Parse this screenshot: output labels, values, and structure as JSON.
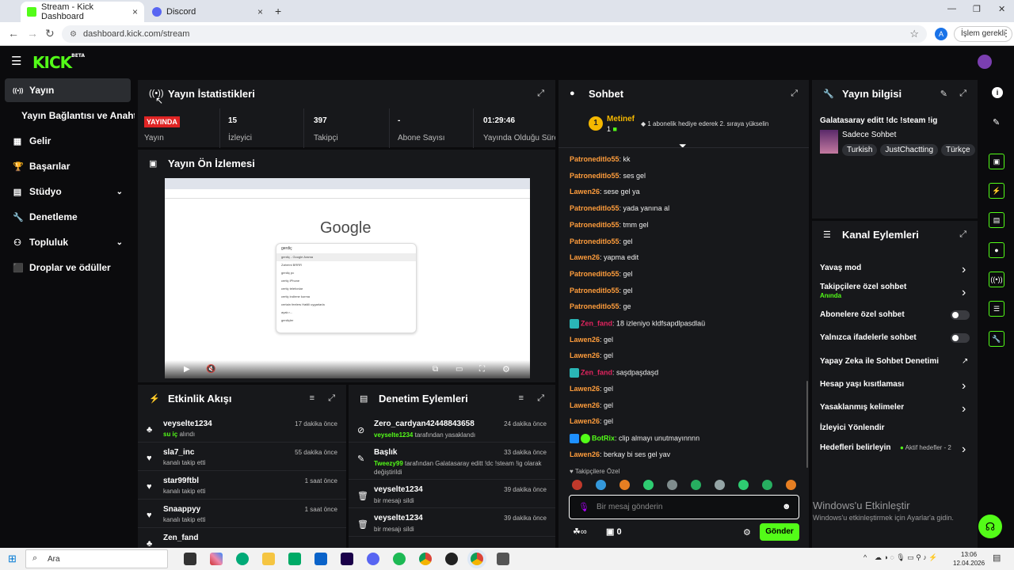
{
  "browser": {
    "tabs": [
      {
        "title": "Stream - Kick Dashboard",
        "close": "×"
      },
      {
        "title": "Discord",
        "close": "×"
      }
    ],
    "new_tab": "+",
    "url": "dashboard.kick.com/stream",
    "update_label": "İşlem gerekli",
    "profile_initial": "A",
    "window_controls": [
      "—",
      "❐",
      "✕"
    ]
  },
  "kick": {
    "logo": "KICK",
    "logo_sup": "BETA"
  },
  "sidebar": {
    "items": [
      {
        "label": "Yayın",
        "icon": "broadcast-icon",
        "active": true
      },
      {
        "label": "Yayın Bağlantısı ve Anahtarı",
        "icon": "",
        "active": false
      },
      {
        "label": "Gelir",
        "icon": "revenue-icon",
        "active": false
      },
      {
        "label": "Başarılar",
        "icon": "trophy-icon",
        "active": false
      },
      {
        "label": "Stüdyo",
        "icon": "studio-icon",
        "active": false,
        "chevron": true
      },
      {
        "label": "Denetleme",
        "icon": "wrench-icon",
        "active": false
      },
      {
        "label": "Topluluk",
        "icon": "community-icon",
        "active": false,
        "chevron": true
      },
      {
        "label": "Droplar ve ödüller",
        "icon": "drops-icon",
        "active": false
      }
    ]
  },
  "stats": {
    "title": "Yayın İstatistikleri",
    "cells": [
      {
        "value": "YAYINDA",
        "label": "Yayın"
      },
      {
        "value": "15",
        "label": "İzleyici"
      },
      {
        "value": "397",
        "label": "Takipçi"
      },
      {
        "value": "-",
        "label": "Abone Sayısı"
      },
      {
        "value": "01:29:46",
        "label": "Yayında Olduğu Süre"
      }
    ]
  },
  "preview": {
    "title": "Yayın Ön İzlemesi",
    "google": "Google",
    "search_text": "gerdiç",
    "suggestions": [
      "gerdiç - Google Arama",
      "Zahrrini BRRR",
      "gerdiç pc",
      "certiç iPhone",
      "certiç telefonlar",
      "certiç indirme kurma",
      "certain feelers Hatiili uygarlarla",
      "ayak r...",
      "gerdiçler"
    ]
  },
  "activity": {
    "title": "Etkinlik Akışı",
    "rows": [
      {
        "name": "veyselte1234",
        "highlight": "su iç",
        "sub": "alındı",
        "time": "17 dakika önce",
        "icon": "redeem-icon"
      },
      {
        "name": "sla7_inc",
        "highlight": "",
        "sub": "kanalı takip etti",
        "time": "55 dakika önce",
        "icon": "heart-icon"
      },
      {
        "name": "star99ftbl",
        "highlight": "",
        "sub": "kanalı takip etti",
        "time": "1 saat önce",
        "icon": "heart-icon"
      },
      {
        "name": "Snaappyy",
        "highlight": "",
        "sub": "kanalı takip etti",
        "time": "1 saat önce",
        "icon": "heart-icon"
      },
      {
        "name": "Zen_fand",
        "highlight": "",
        "sub": "",
        "time": "",
        "icon": "redeem-icon"
      }
    ]
  },
  "moderation": {
    "title": "Denetim Eylemleri",
    "rows": [
      {
        "name": "Zero_cardyan42448843658",
        "sub_user": "veyselte1234",
        "sub": "tarafından yasaklandı",
        "time": "24 dakika önce",
        "icon": "ban-icon"
      },
      {
        "name": "Başlık",
        "sub_user": "Tweezy99",
        "sub": "tarafından Galatasaray editt !dc !steam !ig olarak değiştirildi",
        "time": "33 dakika önce",
        "icon": "edit-icon"
      },
      {
        "name": "veyselte1234",
        "sub_user": "",
        "sub": "bir mesajı sildi",
        "time": "39 dakika önce",
        "icon": "trash-icon"
      },
      {
        "name": "veyselte1234",
        "sub_user": "",
        "sub": "bir mesajı sildi",
        "time": "39 dakika önce",
        "icon": "trash-icon"
      }
    ]
  },
  "chat": {
    "title": "Sohbet",
    "pinned_user": "Metinef",
    "pinned_count": "1",
    "pinned_badge": "1",
    "pinned_text": "1 abonelik hediye ederek 2. sıraya yükselin",
    "messages": [
      {
        "user": "Patroneditlo55",
        "text": "kk",
        "color": "#ff9d3c"
      },
      {
        "user": "Patroneditlo55",
        "text": "ses gel",
        "color": "#ff9d3c"
      },
      {
        "user": "Lawen26",
        "text": "sese gel ya",
        "color": "#ff9d3c"
      },
      {
        "user": "Patroneditlo55",
        "text": "yada yanına al",
        "color": "#ff9d3c"
      },
      {
        "user": "Patroneditlo55",
        "text": "tmm gel",
        "color": "#ff9d3c"
      },
      {
        "user": "Patroneditlo55",
        "text": "gel",
        "color": "#ff9d3c"
      },
      {
        "user": "Lawen26",
        "text": "yapma edit",
        "color": "#ff9d3c"
      },
      {
        "user": "Patroneditlo55",
        "text": "gel",
        "color": "#ff9d3c"
      },
      {
        "user": "Patroneditlo55",
        "text": "gel",
        "color": "#ff9d3c"
      },
      {
        "user": "Patroneditlo55",
        "text": "ge",
        "color": "#ff9d3c"
      },
      {
        "user": "Zen_fand",
        "text": "18 izleniyo kldfsapdlpasdlaü",
        "color": "#e0245e",
        "badge": true
      },
      {
        "user": "Lawen26",
        "text": "gel",
        "color": "#ff9d3c"
      },
      {
        "user": "Lawen26",
        "text": "gel",
        "color": "#ff9d3c"
      },
      {
        "user": "Zen_fand",
        "text": "saşdpaşdaşd",
        "color": "#e0245e",
        "badge": true
      },
      {
        "user": "Lawen26",
        "text": "gel",
        "color": "#ff9d3c"
      },
      {
        "user": "Lawen26",
        "text": "gel",
        "color": "#ff9d3c"
      },
      {
        "user": "Lawen26",
        "text": "gel",
        "color": "#ff9d3c"
      },
      {
        "user": "BotRix",
        "text": "clip almayı unutmayınnnn",
        "color": "#53fc18",
        "badge": true
      },
      {
        "user": "Lawen26",
        "text": "berkay bi ses gel yav",
        "color": "#ff9d3c"
      }
    ],
    "followers_only": "Takipçilere Özel",
    "input_placeholder": "Bir mesaj gönderin",
    "infinity": "∞",
    "gift_count": "0",
    "send": "Gönder"
  },
  "stream_info": {
    "title": "Yayın bilgisi",
    "stream_title": "Galatasaray editt !dc !steam !ig",
    "category": "Sadece Sohbet",
    "tags": [
      "Turkish",
      "JustChactting",
      "Türkçe"
    ]
  },
  "channel_actions": {
    "title": "Kanal Eylemleri",
    "items": [
      {
        "label": "Yavaş mod",
        "control": "arrow"
      },
      {
        "label": "Takipçilere özel sohbet",
        "status": "Anında",
        "control": "arrow"
      },
      {
        "label": "Abonelere özel sohbet",
        "control": "toggle"
      },
      {
        "label": "Yalnızca ifadelerle sohbet",
        "control": "toggle"
      },
      {
        "label": "Yapay Zeka ile Sohbet Denetimi",
        "control": "external"
      },
      {
        "label": "Hesap yaşı kısıtlaması",
        "control": "arrow"
      },
      {
        "label": "Yasaklanmış kelimeler",
        "control": "arrow"
      },
      {
        "label": "İzleyici Yönlendir",
        "control": "none"
      },
      {
        "label": "Hedefleri belirleyin",
        "status": "Aktif hedefler - 2",
        "control": "arrow"
      }
    ]
  },
  "windows_watermark": {
    "title": "Windows'u Etkinleştir",
    "sub": "Windows'u etkinleştirmek için Ayarlar'a gidin."
  },
  "taskbar": {
    "search": "Ara",
    "time": "13:06",
    "date": "12.04.2026"
  },
  "colors": {
    "accent": "#53fc18",
    "panel": "#17181b",
    "background": "#0b0b0d",
    "live": "#e02424"
  }
}
